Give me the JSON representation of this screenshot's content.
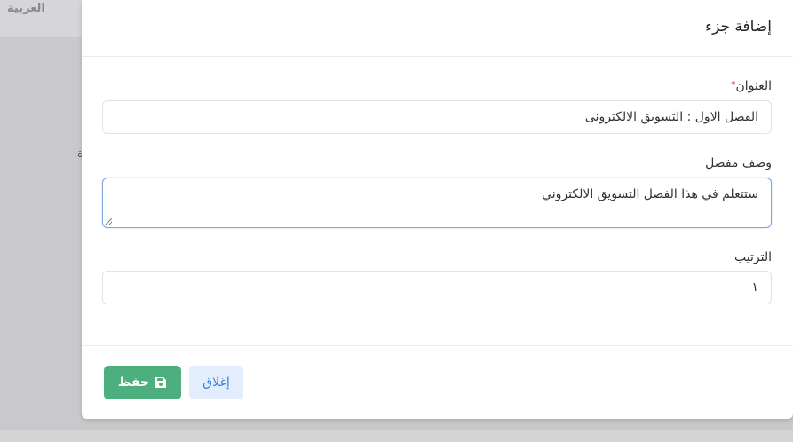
{
  "background": {
    "language_label": "العربية",
    "fragment_char": "ة"
  },
  "modal": {
    "title": "إضافة جزء",
    "fields": {
      "title_label": "العنوان",
      "required_mark": "*",
      "title_value": "الفصل الاول : التسويق الالكترونى",
      "description_label": "وصف مفصل",
      "description_value": "ستتعلم في هذا الفصل التسويق الالكتروني",
      "order_label": "الترتيب",
      "order_value": "١"
    },
    "footer": {
      "close_label": "إغلاق",
      "save_label": "حفظ"
    }
  },
  "colors": {
    "save_button": "#4caf7d",
    "close_button_bg": "#e3eefc",
    "close_button_text": "#3f7ed8",
    "focus_border": "#7ea6e0",
    "required": "#e53935"
  },
  "icons": {
    "save": "floppy-disk-icon",
    "resize": "resize-grip-icon"
  }
}
